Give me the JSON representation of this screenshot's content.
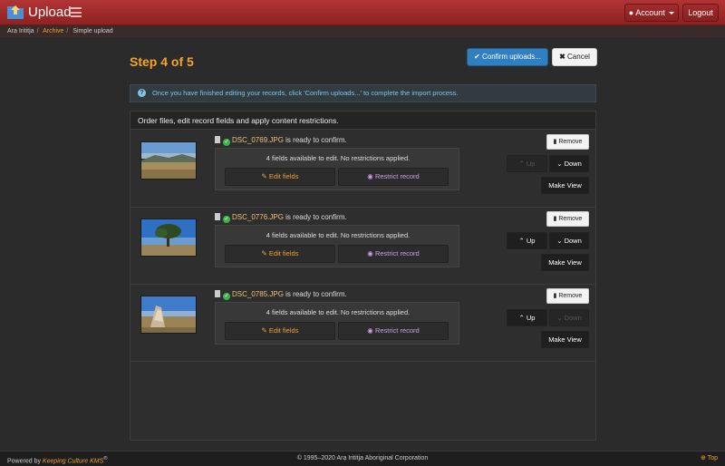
{
  "app": {
    "title": "Upload"
  },
  "nav": {
    "account_label": "Account",
    "logout_label": "Logout"
  },
  "breadcrumb": [
    {
      "label": "Arạ Irititja",
      "link": false
    },
    {
      "label": "Archive",
      "link": true
    },
    {
      "label": "Simple upload",
      "link": false
    }
  ],
  "page": {
    "step_title": "Step 4 of 5",
    "confirm_label": "Confirm uploads...",
    "cancel_label": "Cancel",
    "info_text": "Once you have finished editing your records, click 'Confirm uploads...' to complete the import process.",
    "panel_title": "Order files, edit record fields and apply content restrictions."
  },
  "records": [
    {
      "file_name": "DSC_0769.JPG",
      "status_suffix": "is ready to confirm.",
      "fields_text": "4 fields available to edit. No restrictions applied.",
      "edit_label": "Edit fields",
      "restrict_label": "Restrict record",
      "remove_label": "Remove",
      "up_label": "Up",
      "down_label": "Down",
      "makeview_label": "Make View",
      "up_disabled": true,
      "down_disabled": false,
      "makeview_disabled": true
    },
    {
      "file_name": "DSC_0776.JPG",
      "status_suffix": "is ready to confirm.",
      "fields_text": "4 fields available to edit. No restrictions applied.",
      "edit_label": "Edit fields",
      "restrict_label": "Restrict record",
      "remove_label": "Remove",
      "up_label": "Up",
      "down_label": "Down",
      "makeview_label": "Make View",
      "up_disabled": false,
      "down_disabled": false,
      "makeview_disabled": false
    },
    {
      "file_name": "DSC_0785.JPG",
      "status_suffix": "is ready to confirm.",
      "fields_text": "4 fields available to edit. No restrictions applied.",
      "edit_label": "Edit fields",
      "restrict_label": "Restrict record",
      "remove_label": "Remove",
      "up_label": "Up",
      "down_label": "Down",
      "makeview_label": "Make View",
      "up_disabled": false,
      "down_disabled": true,
      "makeview_disabled": false
    }
  ],
  "footer": {
    "powered_prefix": "Powered by",
    "powered_brand": "Keeping Culture KMS",
    "powered_mark": "®",
    "copyright": "© 1995–2020 Arạ Irititja Aboriginal Corporation",
    "top_label": "Top"
  },
  "colors": {
    "accent": "#f5a623",
    "brand_bar": "#a32b2b",
    "primary": "#2f7fc1"
  },
  "icons": [
    "folder-upload-icon",
    "hamburger-icon",
    "user-icon",
    "caret-down-icon",
    "check-icon",
    "close-icon",
    "info-icon",
    "file-icon",
    "ok-circle-icon",
    "trash-icon",
    "chevron-up-icon",
    "chevron-down-icon",
    "pencil-icon",
    "eye-slash-icon",
    "arrow-up-circle-icon"
  ]
}
